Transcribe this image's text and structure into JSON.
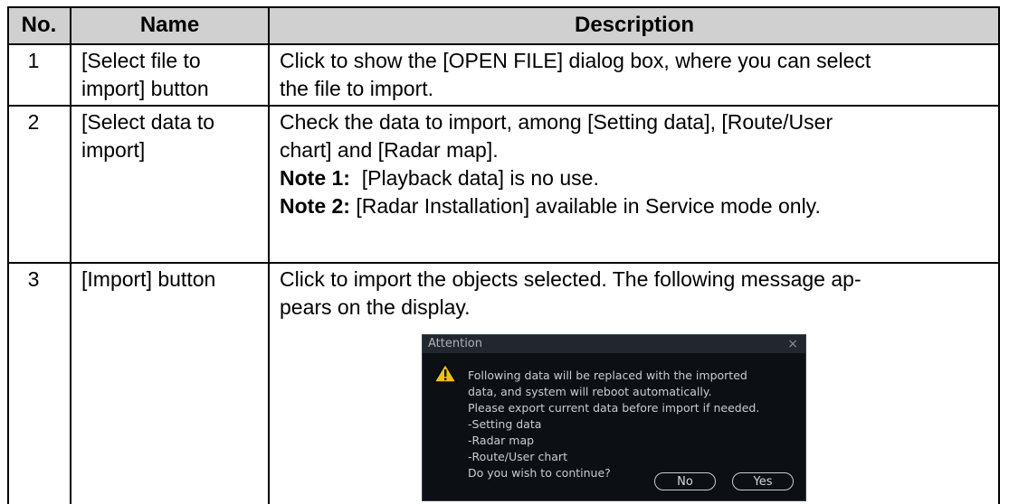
{
  "headers": {
    "no": "No.",
    "name": "Name",
    "description": "Description"
  },
  "rows": [
    {
      "no": "1",
      "name_lines": [
        "[Select file to",
        "import] button"
      ],
      "desc_lines": [
        "Click to show the [OPEN FILE] dialog box, where you can select",
        "the file to import."
      ]
    },
    {
      "no": "2",
      "name_lines": [
        "[Select data to",
        "import]"
      ],
      "desc_lines": [
        "Check the data to import, among [Setting data], [Route/User",
        "chart] and [Radar map]."
      ],
      "notes": [
        {
          "label": "Note 1:",
          "text": "  [Playback data] is no use."
        },
        {
          "label": "Note 2:",
          "text": " [Radar Installation] available in Service mode only."
        }
      ]
    },
    {
      "no": "3",
      "name_lines": [
        "[Import] button"
      ],
      "desc_lines": [
        "Click to import the objects selected. The following message ap-",
        "pears on the display."
      ]
    }
  ],
  "dialog": {
    "title": "Attention",
    "close": "×",
    "message": "Following data will be replaced with the imported\ndata, and system will reboot automatically.\nPlease export current data before import if needed.\n-Setting data\n-Radar map\n-Route/User chart\nDo you wish to continue?",
    "no_label": "No",
    "yes_label": "Yes",
    "warning_icon": "warning-triangle-icon",
    "colors": {
      "background": "#0c0f14",
      "text": "#c9ccd1",
      "icon": "#f2c200"
    }
  }
}
